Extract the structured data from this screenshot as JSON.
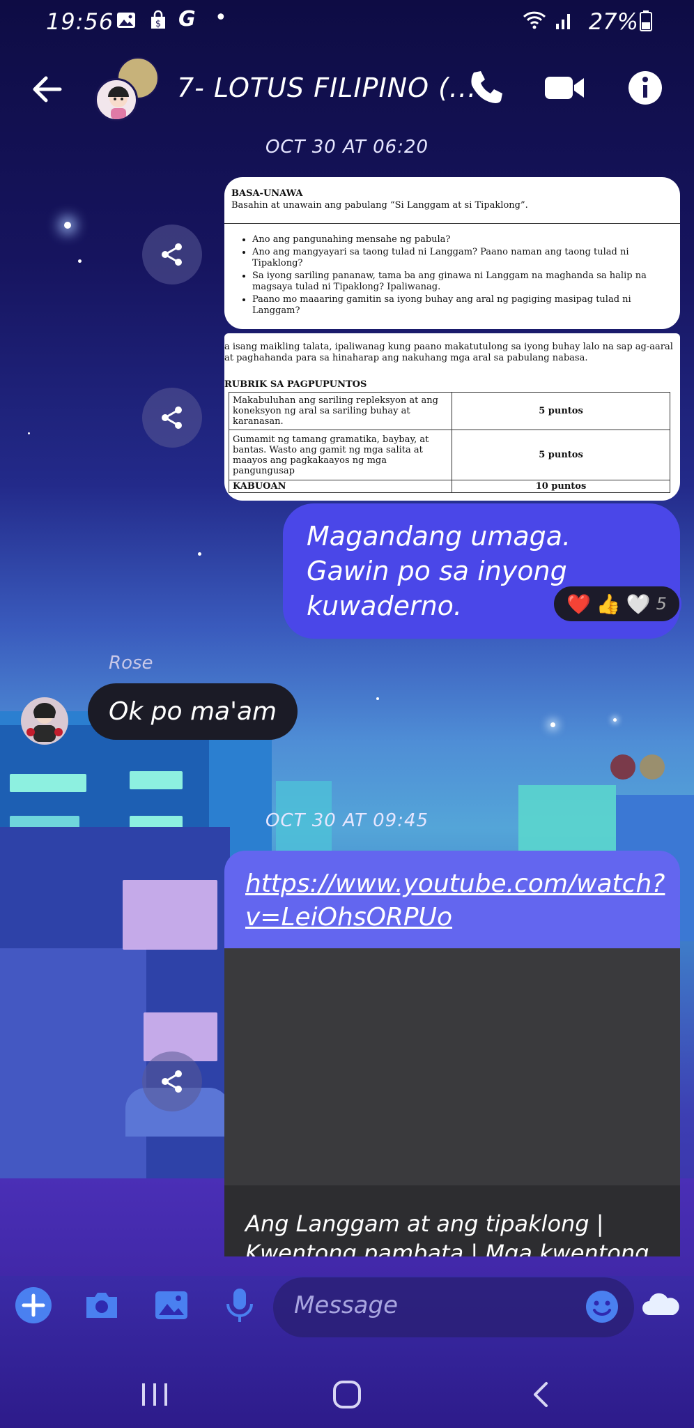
{
  "status_bar": {
    "time": "19:56",
    "google_letter": "G",
    "dot": "•",
    "battery": "27%"
  },
  "header": {
    "title": "7- LOTUS FILIPINO (..."
  },
  "timestamps": [
    "OCT 30 AT 06:20",
    "OCT 30 AT 09:45"
  ],
  "doc1": {
    "heading": "BASA-UNAWA",
    "subheading": "Basahin at unawain ang pabulang “Si Langgam at si Tipaklong”.",
    "questions": [
      "Ano ang pangunahing mensahe ng pabula?",
      "Ano ang mangyayari sa taong tulad ni Langgam? Paano naman ang taong tulad ni Tipaklong?",
      "Sa iyong sariling pananaw, tama ba ang ginawa ni Langgam na maghanda sa halip na magsaya tulad ni Tipaklong? Ipaliwanag.",
      "Paano mo maaaring gamitin sa iyong buhay ang aral ng pagiging masipag tulad ni Langgam?"
    ]
  },
  "doc2": {
    "intro": "a isang maikling talata, ipaliwanag kung paano makatutulong sa iyong buhay lalo na sap ag-aaral at paghahanda para sa hinaharap ang nakuhang mga aral sa pabulang nabasa.",
    "rubric_title": "RUBRIK SA PAGPUPUNTOS",
    "rows": [
      {
        "criteria": "Makabuluhan ang sariling repleksyon at ang koneksyon ng aral sa sariling buhay at karanasan.",
        "points": "5 puntos"
      },
      {
        "criteria": "Gumamit ng tamang gramatika, baybay, at bantas. Wasto ang gamit ng mga salita at maayos ang pagkakaayos ng mga pangungusap",
        "points": "5 puntos"
      },
      {
        "criteria": "KABUOAN",
        "points": "10 puntos"
      }
    ]
  },
  "messages": {
    "outgoing_1": "Magandang umaga. Gawin po sa inyong kuwaderno.",
    "reactions": {
      "emojis": [
        "❤️",
        "👍",
        "🤍"
      ],
      "count": "5"
    },
    "sender_name": "Rose",
    "incoming_1": "Ok po ma'am",
    "link_url": "https://www.youtube.com/watch?v=LeiOhsORPUo",
    "link_title": "Ang Langgam at ang tipaklong | Kwentong pambata | Mga kwentong"
  },
  "composer": {
    "placeholder": "Message"
  },
  "colors": {
    "accent": "#4a47e8",
    "link_bubble": "#6366ef",
    "incoming_bubble": "#1b1b26"
  }
}
